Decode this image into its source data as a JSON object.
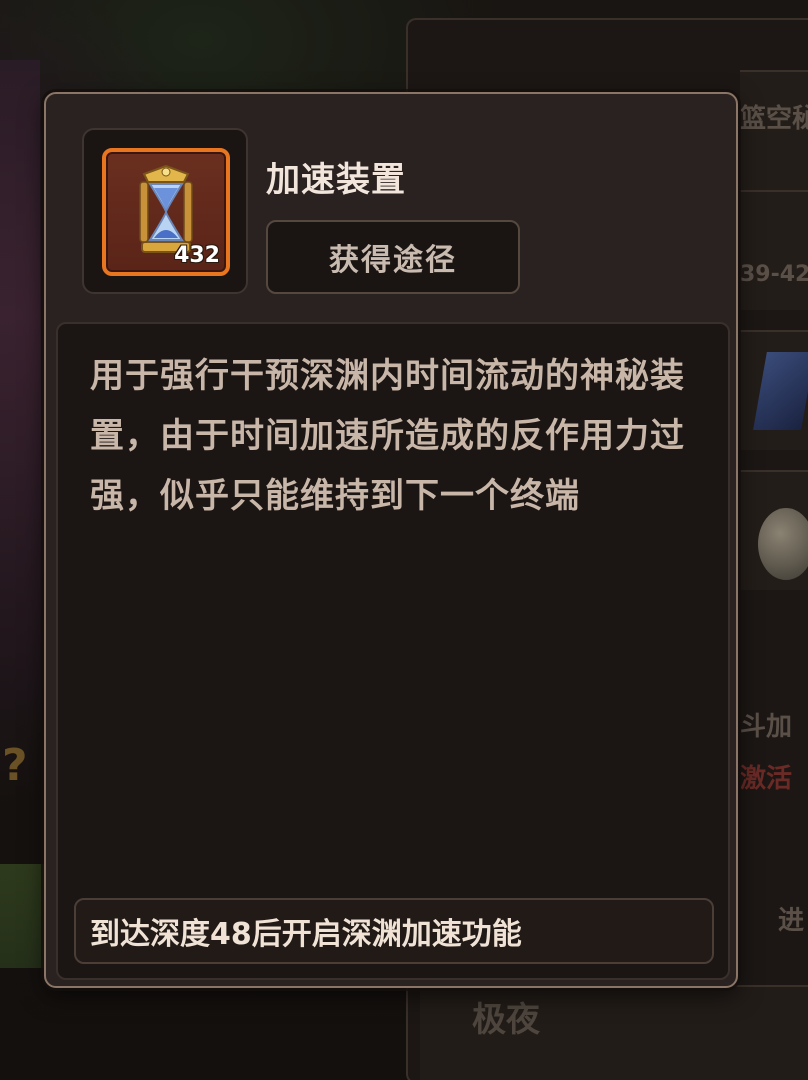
{
  "background": {
    "right_panel_texts": [
      "篮空秘",
      "39-42",
      "斗加",
      "激活",
      "进"
    ],
    "bottom_tile_text": "极夜"
  },
  "tooltip": {
    "item": {
      "name": "加速装置",
      "count": "432",
      "icon": "hourglass-icon",
      "rarity_color": "#e8751f"
    },
    "source_button_label": "获得途径",
    "description": "用于强行干预深渊内时间流动的神秘装置，由于时间加速所造成的反作用力过强，似乎只能维持到下一个终端",
    "unlock_note": "到达深度48后开启深渊加速功能"
  }
}
